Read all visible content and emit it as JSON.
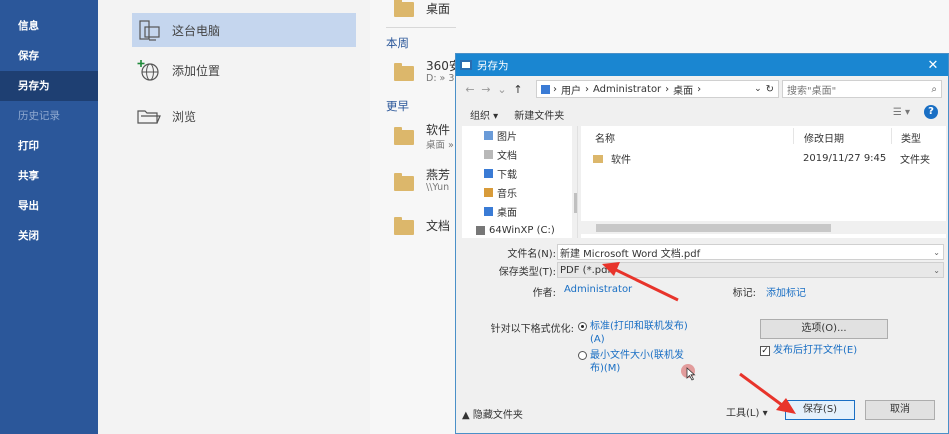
{
  "backstage": {
    "menu": [
      "信息",
      "保存",
      "另存为",
      "历史记录",
      "打印",
      "共享",
      "导出",
      "关闭"
    ],
    "active_index": 2,
    "disabled_index": 3
  },
  "places": {
    "this_pc": "这台电脑",
    "add_place": "添加位置",
    "browse": "浏览"
  },
  "recent": {
    "top_item": "桌面",
    "this_week_header": "本周",
    "this_week_item_name": "360安",
    "this_week_item_path": "D: » 3",
    "earlier_header": "更早",
    "items": [
      {
        "name": "软件",
        "path": "桌面 »"
      },
      {
        "name": "燕芳",
        "path": "\\\\Yun"
      },
      {
        "name": "文档",
        "path": ""
      }
    ]
  },
  "dialog": {
    "title": "另存为",
    "close": "✕",
    "address": [
      "用户",
      "Administrator",
      "桌面"
    ],
    "search_placeholder": "搜索\"桌面\"",
    "toolbar": {
      "organize": "组织 ▾",
      "new_folder": "新建文件夹"
    },
    "nav_tree": [
      "图片",
      "文档",
      "下载",
      "音乐",
      "桌面",
      "64WinXP (C:)"
    ],
    "columns": {
      "name": "名称",
      "date": "修改日期",
      "type": "类型"
    },
    "files": [
      {
        "name": "软件",
        "date": "2019/11/27 9:45",
        "type": "文件夹"
      }
    ],
    "filename_label": "文件名(N):",
    "filename_value": "新建 Microsoft Word 文档.pdf",
    "filetype_label": "保存类型(T):",
    "filetype_value": "PDF (*.pdf)",
    "author_label": "作者:",
    "author_value": "Administrator",
    "tags_label": "标记:",
    "tags_value": "添加标记",
    "optimize_label": "针对以下格式优化:",
    "opt_standard": "标准(打印和联机发布)",
    "opt_standard_key": "(A)",
    "opt_min": "最小文件大小(联机发",
    "opt_min_key": "布)(M)",
    "options_button": "选项(O)...",
    "open_after": "发布后打开文件(E)",
    "hide_folders": "▲ 隐藏文件夹",
    "tools": "工具(L)",
    "tools_caret": "▾",
    "save": "保存(S)",
    "cancel": "取消"
  },
  "colors": {
    "rail": "#2b579a",
    "accent": "#1a86d1",
    "link": "#1a6fc4",
    "arrow": "#e8342b"
  }
}
